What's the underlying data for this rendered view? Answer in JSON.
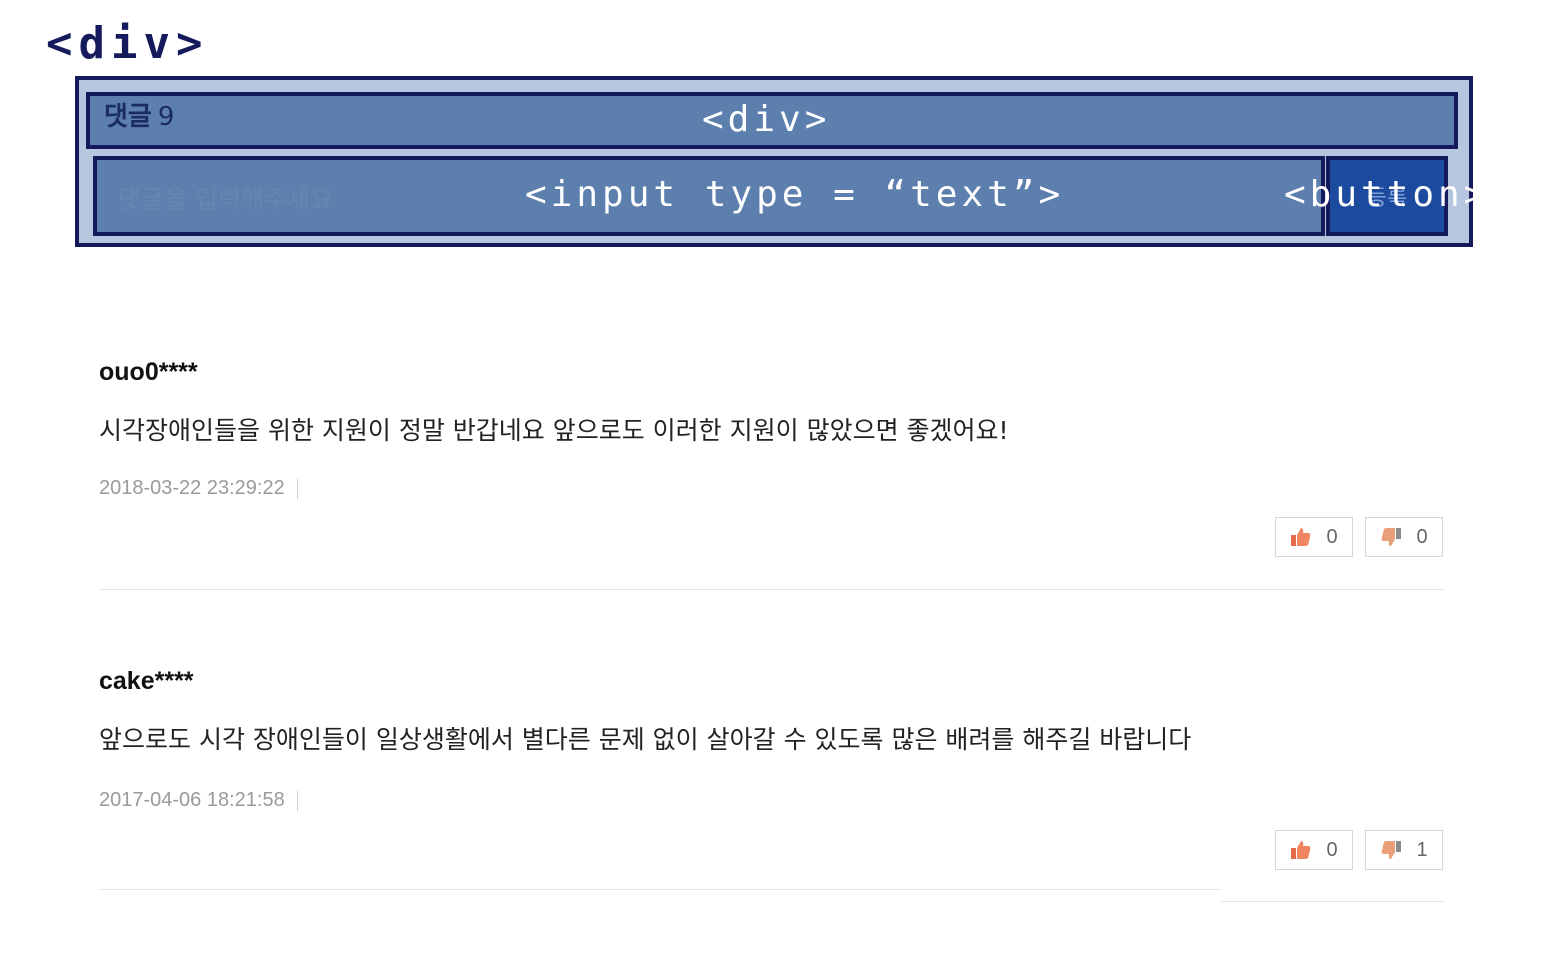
{
  "annotations": {
    "outer": "<div>",
    "header": "<div>",
    "input": "<input type = “text”>",
    "button": "<button>"
  },
  "comment_form": {
    "title": "댓글",
    "count": "9",
    "placeholder": "댓글을 입력해주세요",
    "submit_label": "등록"
  },
  "comments": [
    {
      "author": "ouo0****",
      "text": "시각장애인들을 위한 지원이 정말 반갑네요 앞으로도 이러한 지원이 많았으면 좋겠어요!",
      "date": "2018-03-22 23:29:22",
      "likes": "0",
      "dislikes": "0"
    },
    {
      "author": "cake****",
      "text": "앞으로도 시각 장애인들이 일상생활에서 별다른 문제 없이 살아갈 수 있도록 많은 배려를 해주길 바랍니다",
      "date": "2017-04-06 18:21:58",
      "likes": "0",
      "dislikes": "1"
    }
  ],
  "icons": {
    "like": "thumbs-up-icon",
    "dislike": "thumbs-down-icon"
  },
  "colors": {
    "annotation_border": "#151a5c",
    "annotation_fill": "#5d7fae",
    "button_fill": "#1c4a9e",
    "like_icon": "#e4694a"
  }
}
